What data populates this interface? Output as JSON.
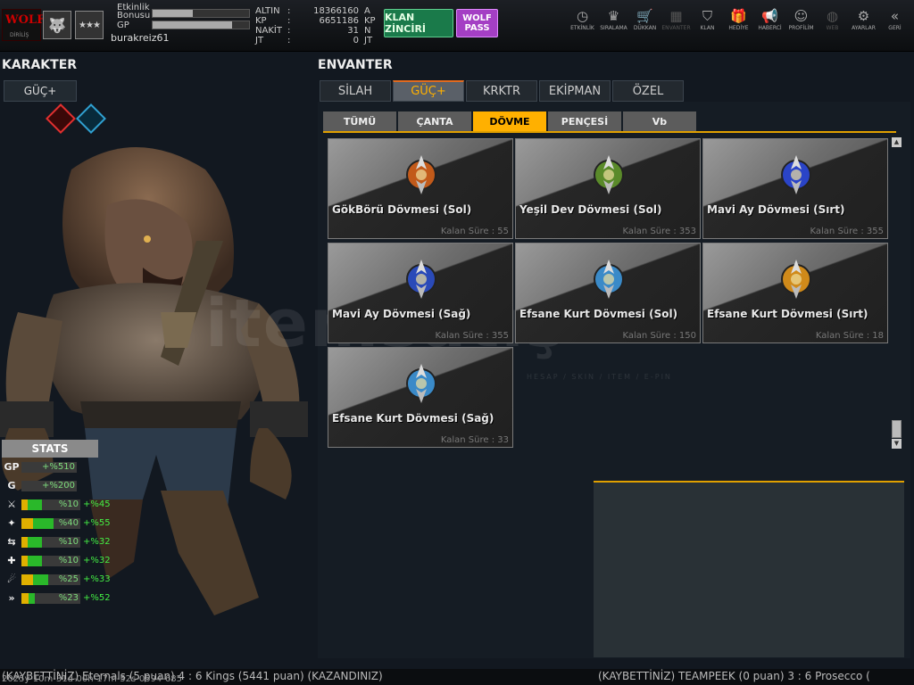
{
  "topbar": {
    "logo_text": "WOLF",
    "logo_sub": "DİRİLİŞ",
    "etkinlik_label_1": "Etkinlik",
    "etkinlik_label_2": "Bonusu",
    "gp_label": "GP",
    "etkinlik_progress": 0.42,
    "gp_progress": 0.82,
    "username": "burakreiz61",
    "currency": [
      {
        "label": "ALTIN",
        "value": "18366160",
        "unit": "A"
      },
      {
        "label": "KP",
        "value": "6651186",
        "unit": "KP"
      },
      {
        "label": "NAKİT",
        "value": "31",
        "unit": "N"
      },
      {
        "label": "JT",
        "value": "0",
        "unit": "JT"
      }
    ],
    "klan_button": "KLAN ZİNCİRİ",
    "wolf_button_1": "WOLF",
    "wolf_button_2": "PASS",
    "menu": [
      {
        "label": "ETKİNLİK",
        "icon": "clock-icon"
      },
      {
        "label": "SIRALAMA",
        "icon": "rank-icon"
      },
      {
        "label": "DÜKKAN",
        "icon": "cart-icon"
      },
      {
        "label": "ENVANTER",
        "icon": "inventory-icon"
      },
      {
        "label": "KLAN",
        "icon": "shield-icon"
      },
      {
        "label": "HEDİYE",
        "icon": "gift-icon"
      },
      {
        "label": "HABERCİ",
        "icon": "megaphone-icon"
      },
      {
        "label": "PROFİLİM",
        "icon": "profile-icon"
      },
      {
        "label": "WEB",
        "icon": "globe-icon"
      },
      {
        "label": "AYARLAR",
        "icon": "gear-icon"
      },
      {
        "label": "GERİ",
        "icon": "back-icon"
      }
    ]
  },
  "left": {
    "title": "KARAKTER",
    "tab": "GÜÇ+",
    "stats_title": "STATS",
    "stats": [
      {
        "icon": "GP",
        "value": "+%510",
        "kind": "single"
      },
      {
        "icon": "G",
        "value": "+%200",
        "kind": "single"
      },
      {
        "icon": "⚔",
        "value": "%10",
        "bonus": "+%45",
        "y": 0.1,
        "g": 0.25
      },
      {
        "icon": "✦",
        "value": "%40",
        "bonus": "+%55",
        "y": 0.2,
        "g": 0.35
      },
      {
        "icon": "⇆",
        "value": "%10",
        "bonus": "+%32",
        "y": 0.1,
        "g": 0.25
      },
      {
        "icon": "✚",
        "value": "%10",
        "bonus": "+%32",
        "y": 0.1,
        "g": 0.25
      },
      {
        "icon": "☄",
        "value": "%25",
        "bonus": "+%33",
        "y": 0.2,
        "g": 0.25
      },
      {
        "icon": "»",
        "value": "%23",
        "bonus": "+%52",
        "y": 0.12,
        "g": 0.1
      }
    ]
  },
  "envanter": {
    "title": "ENVANTER",
    "main_tabs": [
      "SİLAH",
      "GÜÇ+",
      "KRKTR",
      "EKİPMAN",
      "ÖZEL"
    ],
    "main_active": 1,
    "sub_tabs": [
      "TÜMÜ",
      "ÇANTA",
      "DÖVME",
      "PENÇESİ",
      "Vb"
    ],
    "sub_active": 2,
    "items": [
      {
        "name": "GökBörü Dövmesi (Sol)",
        "time": "Kalan Süre : 55",
        "color": "#c25a1a"
      },
      {
        "name": "Yeşil Dev Dövmesi (Sol)",
        "time": "Kalan Süre : 353",
        "color": "#5a8a2a"
      },
      {
        "name": "Mavi Ay Dövmesi (Sırt)",
        "time": "Kalan Süre : 355",
        "color": "#2a44c8"
      },
      {
        "name": "Mavi Ay Dövmesi (Sağ)",
        "time": "Kalan Süre : 355",
        "color": "#2a4ab8"
      },
      {
        "name": "Efsane Kurt Dövmesi (Sol)",
        "time": "Kalan Süre : 150",
        "color": "#3a8ac8"
      },
      {
        "name": "Efsane Kurt Dövmesi (Sırt)",
        "time": "Kalan Süre : 18",
        "color": "#d08a1a"
      },
      {
        "name": "Efsane Kurt Dövmesi (Sağ)",
        "time": "Kalan Süre : 33",
        "color": "#3a8ac8"
      }
    ]
  },
  "watermark": {
    "main": "itemsatış",
    "sub": "HESAP / SKIN / ITEM / E-PIN"
  },
  "ticker": {
    "left": "(KAYBETTİNİZ) Eternals (5 puan) 4 : 6 Kings (5441 puan) (KAZANDINIZ)",
    "right": "(KAYBETTİNİZ) TEAMPEEK (0 puan) 3 : 6 Prosecco (",
    "timestamp": "2025y-10m-31d-00h-17m-52s-0594-685"
  }
}
